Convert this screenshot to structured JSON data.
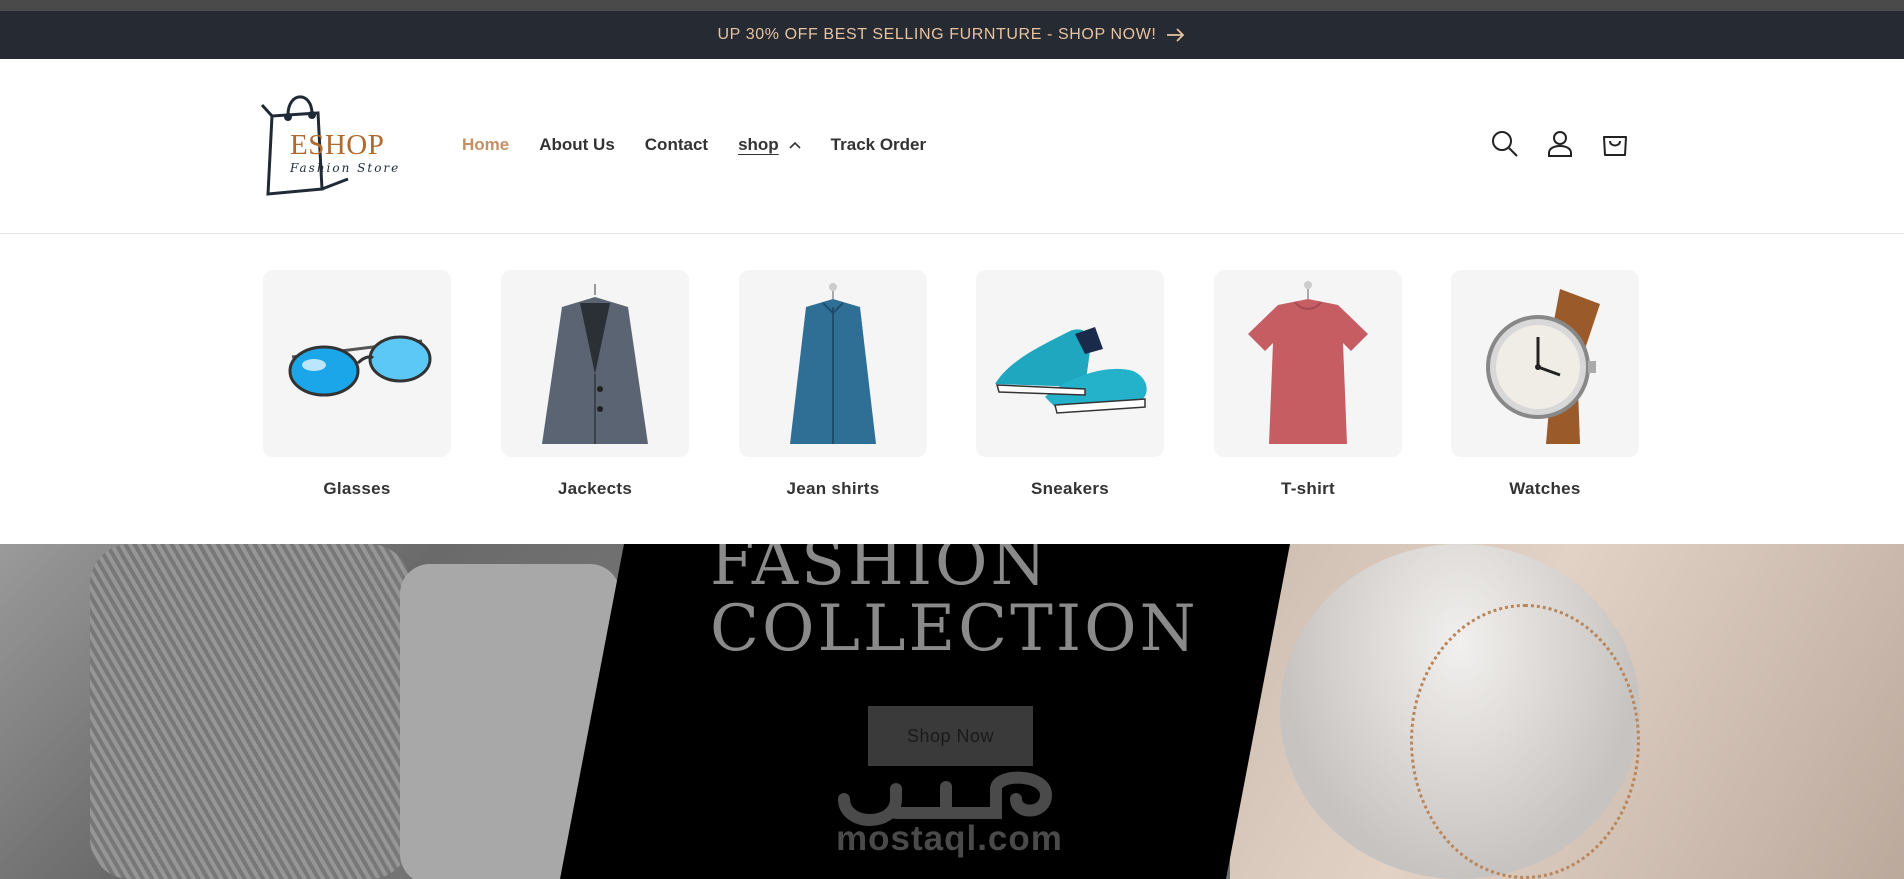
{
  "announcement": {
    "text": "UP 30% OFF BEST SELLING FURNTURE - SHOP NOW!",
    "icon": "arrow-right-icon"
  },
  "logo": {
    "name": "ESHOP",
    "tagline": "Fashion Store"
  },
  "nav": {
    "home": "Home",
    "about": "About Us",
    "contact": "Contact",
    "shop": "shop",
    "track": "Track Order"
  },
  "header_icons": [
    "search-icon",
    "account-icon",
    "cart-icon"
  ],
  "categories": [
    {
      "label": "Glasses",
      "icon": "glasses-icon"
    },
    {
      "label": "Jackects",
      "icon": "jacket-icon"
    },
    {
      "label": "Jean shirts",
      "icon": "shirt-icon"
    },
    {
      "label": "Sneakers",
      "icon": "sneaker-icon"
    },
    {
      "label": "T-shirt",
      "icon": "tshirt-icon"
    },
    {
      "label": "Watches",
      "icon": "watch-icon"
    }
  ],
  "hero": {
    "title_line1": "FASHION",
    "title_line2": "COLLECTION",
    "button": "Shop Now"
  },
  "watermark": {
    "arabic": "مستقل",
    "latin": "mostaql.com"
  },
  "colors": {
    "announcement_bg": "#262a33",
    "announcement_text": "#e8c3a0",
    "accent": "#c49064",
    "brand": "#b06a2f"
  }
}
